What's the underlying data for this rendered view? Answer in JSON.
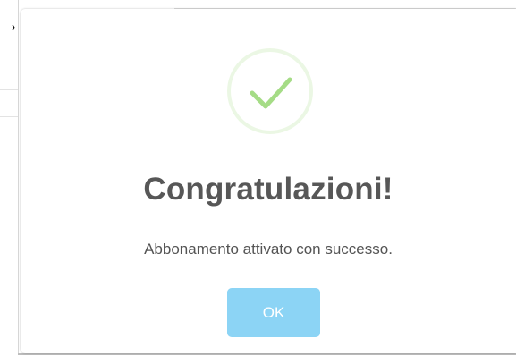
{
  "background": {
    "glyph": "›"
  },
  "dialog": {
    "icon": "success-check-icon",
    "title": "Congratulazioni!",
    "message": "Abbonamento attivato con successo.",
    "confirm_label": "OK"
  },
  "colors": {
    "check": "#a5dc86",
    "button": "#8cd4f5",
    "title": "#575757",
    "message": "#545454"
  }
}
